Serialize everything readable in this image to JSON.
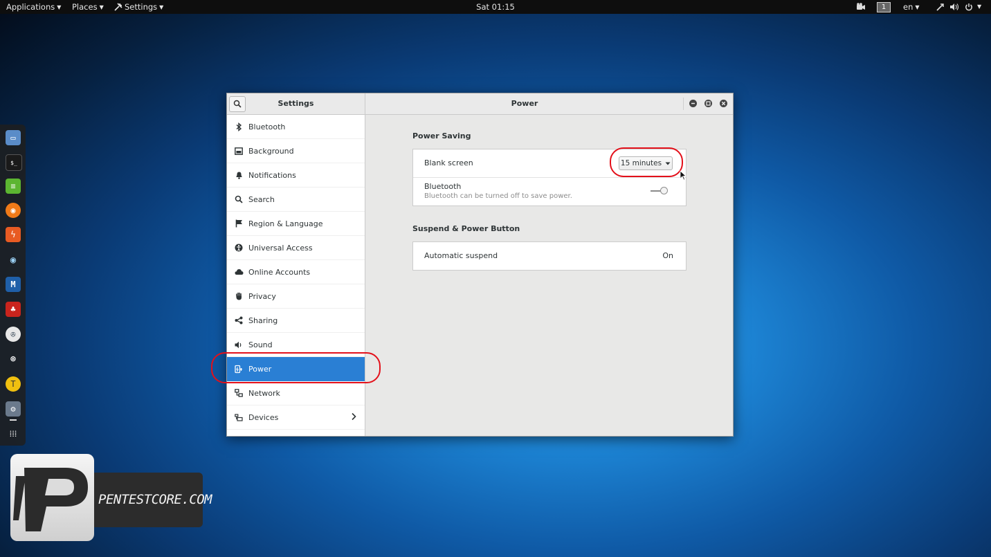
{
  "topbar": {
    "applications": "Applications",
    "places": "Places",
    "settings": "Settings",
    "clock": "Sat 01:15",
    "workspace": "1",
    "language": "en"
  },
  "dock": {
    "items": [
      "files-icon",
      "terminal-icon",
      "text-editor-icon",
      "firefox-icon",
      "burpsuite-icon",
      "eye-icon",
      "metasploit-icon",
      "cherrytree-icon",
      "maltego-icon",
      "wireless-icon",
      "beef-icon",
      "settings-icon",
      "show-apps-icon"
    ]
  },
  "window": {
    "sidebar_title": "Settings",
    "panel_title": "Power"
  },
  "sidebar": {
    "items": [
      {
        "label": "Bluetooth",
        "icon": "bluetooth-icon"
      },
      {
        "label": "Background",
        "icon": "background-icon"
      },
      {
        "label": "Notifications",
        "icon": "bell-icon"
      },
      {
        "label": "Search",
        "icon": "search-icon"
      },
      {
        "label": "Region & Language",
        "icon": "flag-icon"
      },
      {
        "label": "Universal Access",
        "icon": "accessibility-icon"
      },
      {
        "label": "Online Accounts",
        "icon": "cloud-icon"
      },
      {
        "label": "Privacy",
        "icon": "hand-icon"
      },
      {
        "label": "Sharing",
        "icon": "share-icon"
      },
      {
        "label": "Sound",
        "icon": "speaker-icon"
      },
      {
        "label": "Power",
        "icon": "power-plug-icon"
      },
      {
        "label": "Network",
        "icon": "network-icon"
      },
      {
        "label": "Devices",
        "icon": "devices-icon"
      }
    ]
  },
  "main": {
    "power_saving": {
      "heading": "Power Saving",
      "blank_screen_label": "Blank screen",
      "blank_screen_value": "15 minutes",
      "bluetooth_label": "Bluetooth",
      "bluetooth_sub": "Bluetooth can be turned off to save power."
    },
    "suspend": {
      "heading": "Suspend & Power Button",
      "auto_suspend_label": "Automatic suspend",
      "auto_suspend_value": "On"
    }
  },
  "watermark": {
    "text": "PENTESTCORE.COM"
  },
  "colors": {
    "accent": "#2a7fd4",
    "annotation": "#e3101a"
  }
}
